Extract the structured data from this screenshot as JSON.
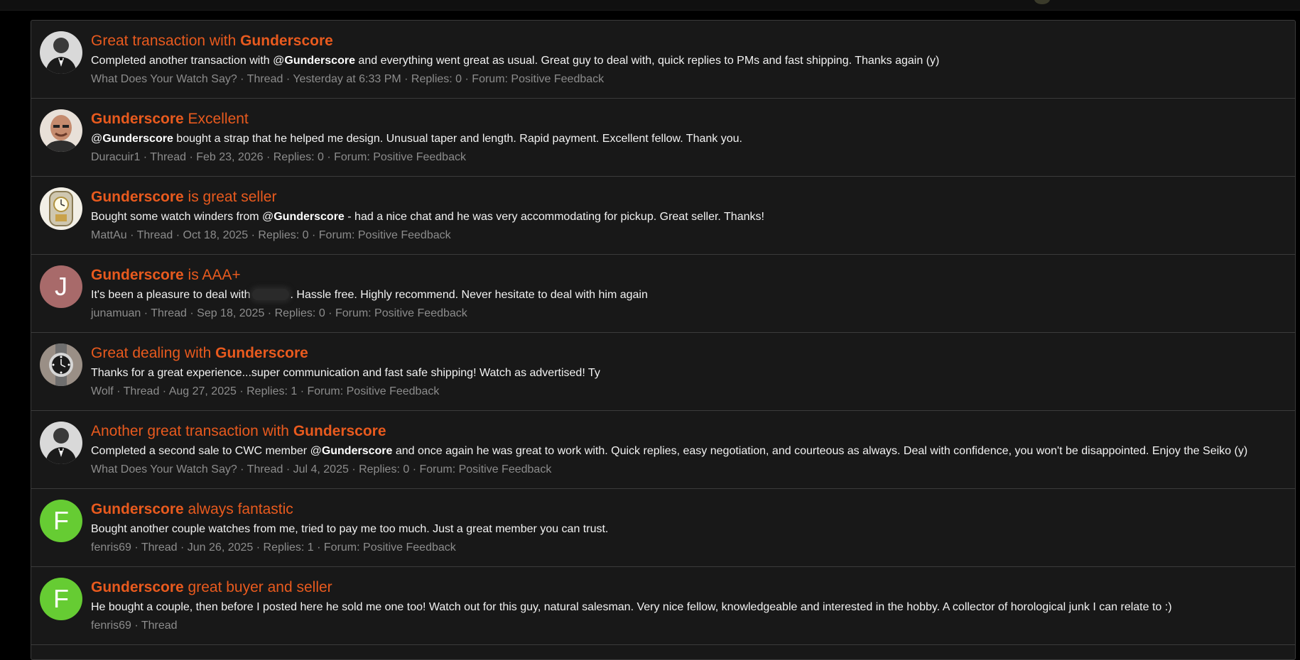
{
  "colors": {
    "background": "#000000",
    "panel": "#181818",
    "title": "#e85a1e",
    "text": "#f2f2f2",
    "meta": "#8c8c8c",
    "divider": "#3b3b3b"
  },
  "results": [
    {
      "avatar": {
        "type": "image",
        "icon": "tuxedo-man-avatar"
      },
      "title": [
        {
          "text": "Great transaction with ",
          "bold": false
        },
        {
          "text": "Gunderscore",
          "bold": true
        }
      ],
      "snippet": [
        {
          "text": "Completed another transaction with @",
          "bold": false
        },
        {
          "text": "Gunderscore",
          "bold": true
        },
        {
          "text": " and everything went great as usual. Great guy to deal with, quick replies to PMs and fast shipping. Thanks again (y)",
          "bold": false
        }
      ],
      "author": "What Does Your Watch Say?",
      "type": "Thread",
      "date": "Yesterday at 6:33 PM",
      "replies": "Replies: 0",
      "forum": "Forum: Positive Feedback"
    },
    {
      "avatar": {
        "type": "image",
        "icon": "bald-man-avatar"
      },
      "title": [
        {
          "text": "Gunderscore",
          "bold": true
        },
        {
          "text": " Excellent",
          "bold": false
        }
      ],
      "snippet": [
        {
          "text": "@",
          "bold": false
        },
        {
          "text": "Gunderscore",
          "bold": true
        },
        {
          "text": " bought a strap that he helped me design. Unusual taper and length. Rapid payment. Excellent fellow. Thank you.",
          "bold": false
        }
      ],
      "author": "Duracuir1",
      "type": "Thread",
      "date": "Feb 23, 2026",
      "replies": "Replies: 0",
      "forum": "Forum: Positive Feedback"
    },
    {
      "avatar": {
        "type": "image",
        "icon": "clock-avatar"
      },
      "title": [
        {
          "text": "Gunderscore",
          "bold": true
        },
        {
          "text": " is great seller",
          "bold": false
        }
      ],
      "snippet": [
        {
          "text": "Bought some watch winders from @",
          "bold": false
        },
        {
          "text": "Gunderscore",
          "bold": true
        },
        {
          "text": " - had a nice chat and he was very accommodating for pickup. Great seller. Thanks!",
          "bold": false
        }
      ],
      "author": "MattAu",
      "type": "Thread",
      "date": "Oct 18, 2025",
      "replies": "Replies: 0",
      "forum": "Forum: Positive Feedback"
    },
    {
      "avatar": {
        "type": "letter",
        "letter": "J",
        "color": "#a86a6a"
      },
      "title": [
        {
          "text": "Gunderscore",
          "bold": true
        },
        {
          "text": " is AAA+",
          "bold": false
        }
      ],
      "snippet": [
        {
          "text": "It's been a pleasure to deal with",
          "bold": false
        },
        {
          "redacted": true
        },
        {
          "text": ". Hassle free. Highly recommend. Never hesitate to deal with him again",
          "bold": false
        }
      ],
      "author": "junamuan",
      "type": "Thread",
      "date": "Sep 18, 2025",
      "replies": "Replies: 0",
      "forum": "Forum: Positive Feedback"
    },
    {
      "avatar": {
        "type": "image",
        "icon": "wristwatch-avatar"
      },
      "title": [
        {
          "text": "Great dealing with ",
          "bold": false
        },
        {
          "text": "Gunderscore",
          "bold": true
        }
      ],
      "snippet": [
        {
          "text": "Thanks for a great experience...super communication and fast safe shipping! Watch as advertised! Ty",
          "bold": false
        }
      ],
      "author": "Wolf",
      "type": "Thread",
      "date": "Aug 27, 2025",
      "replies": "Replies: 1",
      "forum": "Forum: Positive Feedback"
    },
    {
      "avatar": {
        "type": "image",
        "icon": "tuxedo-man-avatar"
      },
      "title": [
        {
          "text": "Another great transaction with ",
          "bold": false
        },
        {
          "text": "Gunderscore",
          "bold": true
        }
      ],
      "snippet": [
        {
          "text": "Completed a second sale to CWC member @",
          "bold": false
        },
        {
          "text": "Gunderscore",
          "bold": true
        },
        {
          "text": " and once again he was great to work with. Quick replies, easy negotiation, and courteous as always. Deal with confidence, you won't be disappointed. Enjoy the Seiko (y)",
          "bold": false
        }
      ],
      "author": "What Does Your Watch Say?",
      "type": "Thread",
      "date": "Jul 4, 2025",
      "replies": "Replies: 0",
      "forum": "Forum: Positive Feedback"
    },
    {
      "avatar": {
        "type": "letter",
        "letter": "F",
        "color": "#66cc33"
      },
      "title": [
        {
          "text": "Gunderscore",
          "bold": true
        },
        {
          "text": " always fantastic",
          "bold": false
        }
      ],
      "snippet": [
        {
          "text": "Bought another couple watches from me, tried to pay me too much. Just a great member you can trust.",
          "bold": false
        }
      ],
      "author": "fenris69",
      "type": "Thread",
      "date": "Jun 26, 2025",
      "replies": "Replies: 1",
      "forum": "Forum: Positive Feedback"
    },
    {
      "avatar": {
        "type": "letter",
        "letter": "F",
        "color": "#66cc33"
      },
      "title": [
        {
          "text": "Gunderscore",
          "bold": true
        },
        {
          "text": " great buyer and seller",
          "bold": false
        }
      ],
      "snippet": [
        {
          "text": "He bought a couple, then before I posted here he sold me one too! Watch out for this guy, natural salesman. Very nice fellow, knowledgeable and interested in the hobby. A collector of horological junk I can relate to :)",
          "bold": false
        }
      ],
      "author": "fenris69",
      "type": "Thread",
      "date": "",
      "replies": "",
      "forum": ""
    }
  ]
}
